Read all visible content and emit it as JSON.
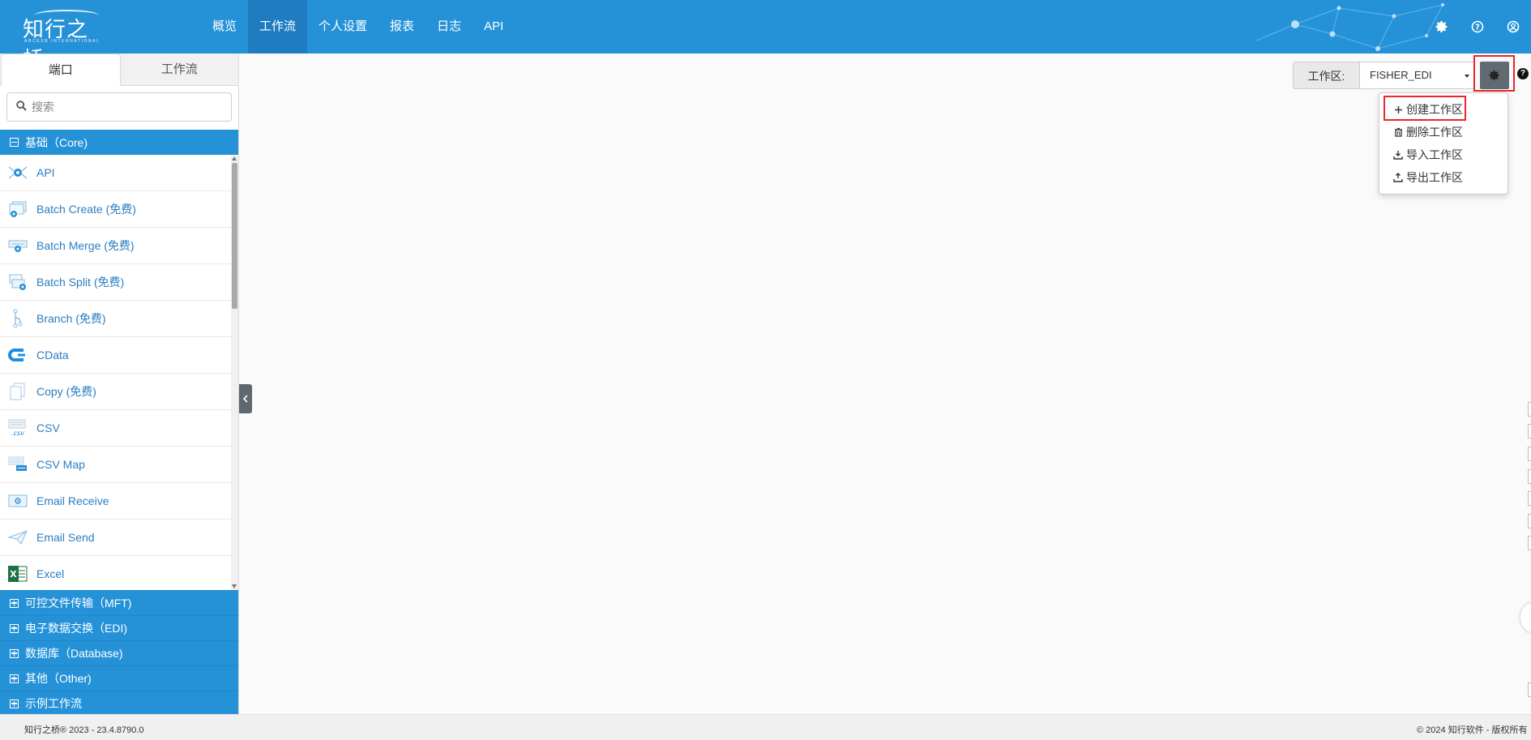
{
  "header": {
    "logo_text": "知行之桥",
    "logo_sub": "ARCESB INTERNATIONAL",
    "nav": [
      {
        "label": "概览"
      },
      {
        "label": "工作流"
      },
      {
        "label": "个人设置"
      },
      {
        "label": "报表"
      },
      {
        "label": "日志"
      },
      {
        "label": "API"
      }
    ],
    "active_nav": "工作流",
    "icons": [
      "settings-icon",
      "help-icon",
      "user-icon"
    ]
  },
  "sidebar": {
    "tabs": [
      {
        "label": "端口"
      },
      {
        "label": "工作流"
      }
    ],
    "search": {
      "placeholder": "搜索",
      "value": ""
    },
    "core": {
      "label": "基础（Core)"
    },
    "ports": [
      {
        "label": "API",
        "icon": "api-gear-icon"
      },
      {
        "label": "Batch Create (免费)",
        "icon": "batch-create-icon"
      },
      {
        "label": "Batch Merge (免费)",
        "icon": "batch-merge-icon"
      },
      {
        "label": "Batch Split (免费)",
        "icon": "batch-split-icon"
      },
      {
        "label": "Branch (免费)",
        "icon": "branch-icon"
      },
      {
        "label": "CData",
        "icon": "cdata-icon"
      },
      {
        "label": "Copy (免费)",
        "icon": "copy-icon"
      },
      {
        "label": "CSV",
        "icon": "csv-icon"
      },
      {
        "label": "CSV Map",
        "icon": "csv-map-icon"
      },
      {
        "label": "Email Receive",
        "icon": "email-receive-icon"
      },
      {
        "label": "Email Send",
        "icon": "email-send-icon"
      },
      {
        "label": "Excel",
        "icon": "excel-icon"
      }
    ],
    "categories": [
      {
        "label": "可控文件传输（MFT)"
      },
      {
        "label": "电子数据交换（EDI)"
      },
      {
        "label": "数据库（Database)"
      },
      {
        "label": "其他（Other)"
      },
      {
        "label": "示例工作流"
      }
    ]
  },
  "workspace": {
    "label": "工作区:",
    "selected": "FISHER_EDI",
    "menu": [
      {
        "label": "创建工作区",
        "icon": "plus-icon"
      },
      {
        "label": "删除工作区",
        "icon": "trash-icon"
      },
      {
        "label": "导入工作区",
        "icon": "import-icon"
      },
      {
        "label": "导出工作区",
        "icon": "export-icon"
      }
    ]
  },
  "footer": {
    "left": "知行之桥® 2023 - 23.4.8790.0",
    "right": "© 2024 知行软件 - 版权所有"
  },
  "colors": {
    "brand": "#2592d8",
    "highlight": "#e8262b",
    "link": "#2a7ec2"
  }
}
